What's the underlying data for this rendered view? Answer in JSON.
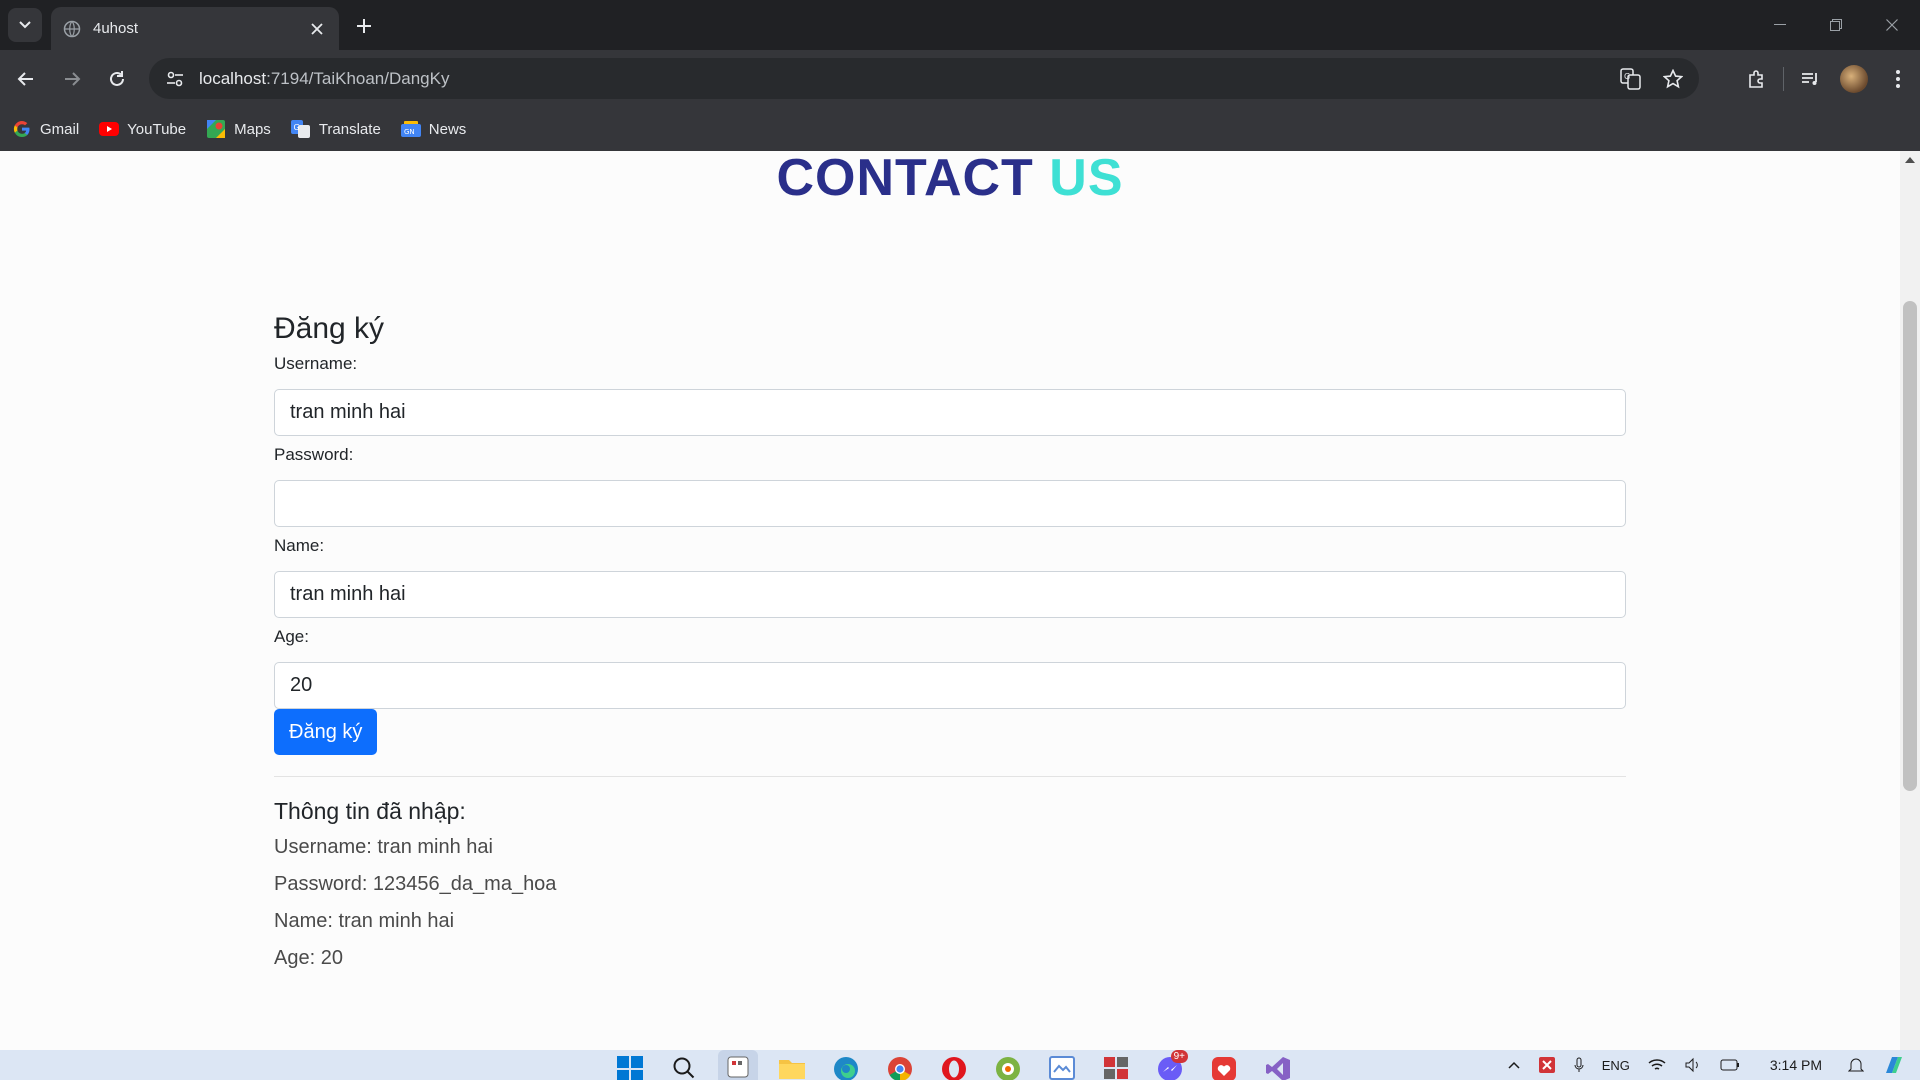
{
  "browser": {
    "tab_title": "4uhost",
    "url_host": "localhost",
    "url_path": ":7194/TaiKhoan/DangKy",
    "bookmarks": [
      {
        "label": "Gmail",
        "icon": "google-icon"
      },
      {
        "label": "YouTube",
        "icon": "youtube-icon"
      },
      {
        "label": "Maps",
        "icon": "maps-icon"
      },
      {
        "label": "Translate",
        "icon": "translate-icon"
      },
      {
        "label": "News",
        "icon": "news-icon"
      }
    ]
  },
  "page": {
    "heading_part1": "CONTACT",
    "heading_part2": "US",
    "heading_colors": {
      "part1": "#2a2f8a",
      "part2": "#3ee0d4"
    },
    "form": {
      "title": "Đăng ký",
      "username_label": "Username:",
      "username_value": "tran minh hai",
      "password_label": "Password:",
      "password_value": "",
      "name_label": "Name:",
      "name_value": "tran minh hai",
      "age_label": "Age:",
      "age_value": "20",
      "submit_label": "Đăng ký",
      "submit_color": "#0d6efd"
    },
    "info": {
      "title": "Thông tin đã nhập:",
      "username": "Username: tran minh hai",
      "password": "Password: 123456_da_ma_hoa",
      "name": "Name: tran minh hai",
      "age": "Age: 20"
    }
  },
  "taskbar": {
    "clock": "3:14 PM",
    "language": "ENG",
    "chat_badge": "9+"
  }
}
